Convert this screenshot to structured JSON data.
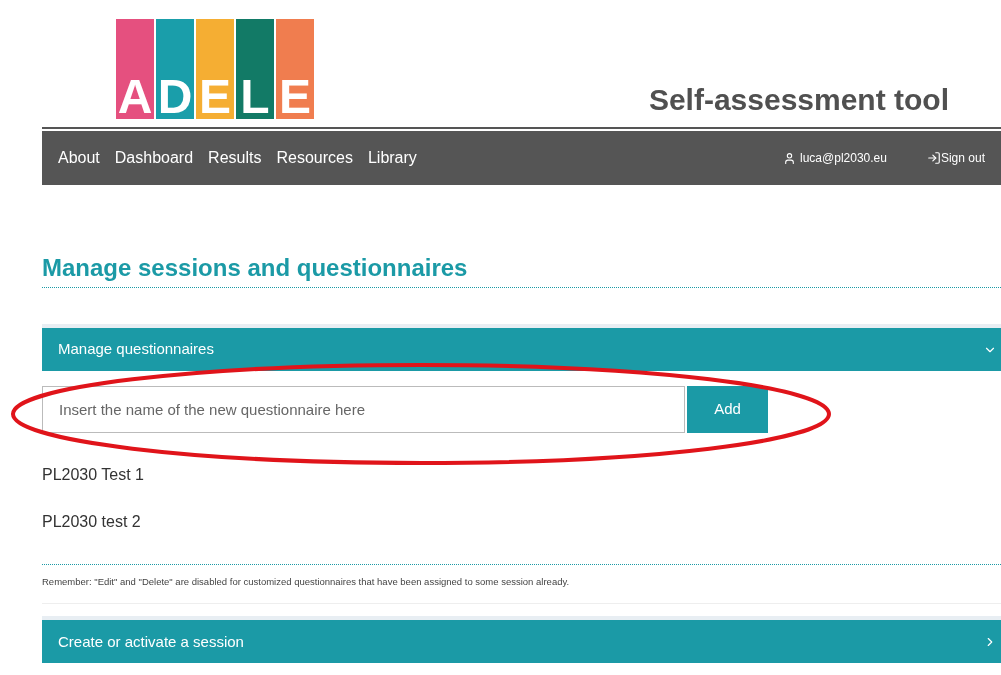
{
  "logo": {
    "letters": [
      {
        "char": "A",
        "color": "#e5507f"
      },
      {
        "char": "D",
        "color": "#1a9eaa"
      },
      {
        "char": "E",
        "color": "#f5ae33"
      },
      {
        "char": "L",
        "color": "#127a66"
      },
      {
        "char": "E",
        "color": "#f07d4f"
      }
    ]
  },
  "app_title": "Self-assessment tool",
  "nav": {
    "items": [
      "About",
      "Dashboard",
      "Results",
      "Resources",
      "Library"
    ],
    "user": "luca@pl2030.eu",
    "sign_out": "Sign out"
  },
  "page_title": "Manage sessions and questionnaires",
  "sections": [
    {
      "title": "Manage questionnaires",
      "expanded": true,
      "input": {
        "placeholder": "Insert the name of the new questionnaire here"
      },
      "add_button": "Add",
      "questionnaires": [
        "PL2030 Test 1",
        "PL2030 test 2"
      ],
      "note": "Remember: \"Edit\" and \"Delete\" are disabled for customized questionnaires that have been assigned to some session already."
    },
    {
      "title": "Create or activate a session",
      "expanded": false
    }
  ],
  "annotation": {
    "kind": "ellipse",
    "color": "#e0141a"
  }
}
